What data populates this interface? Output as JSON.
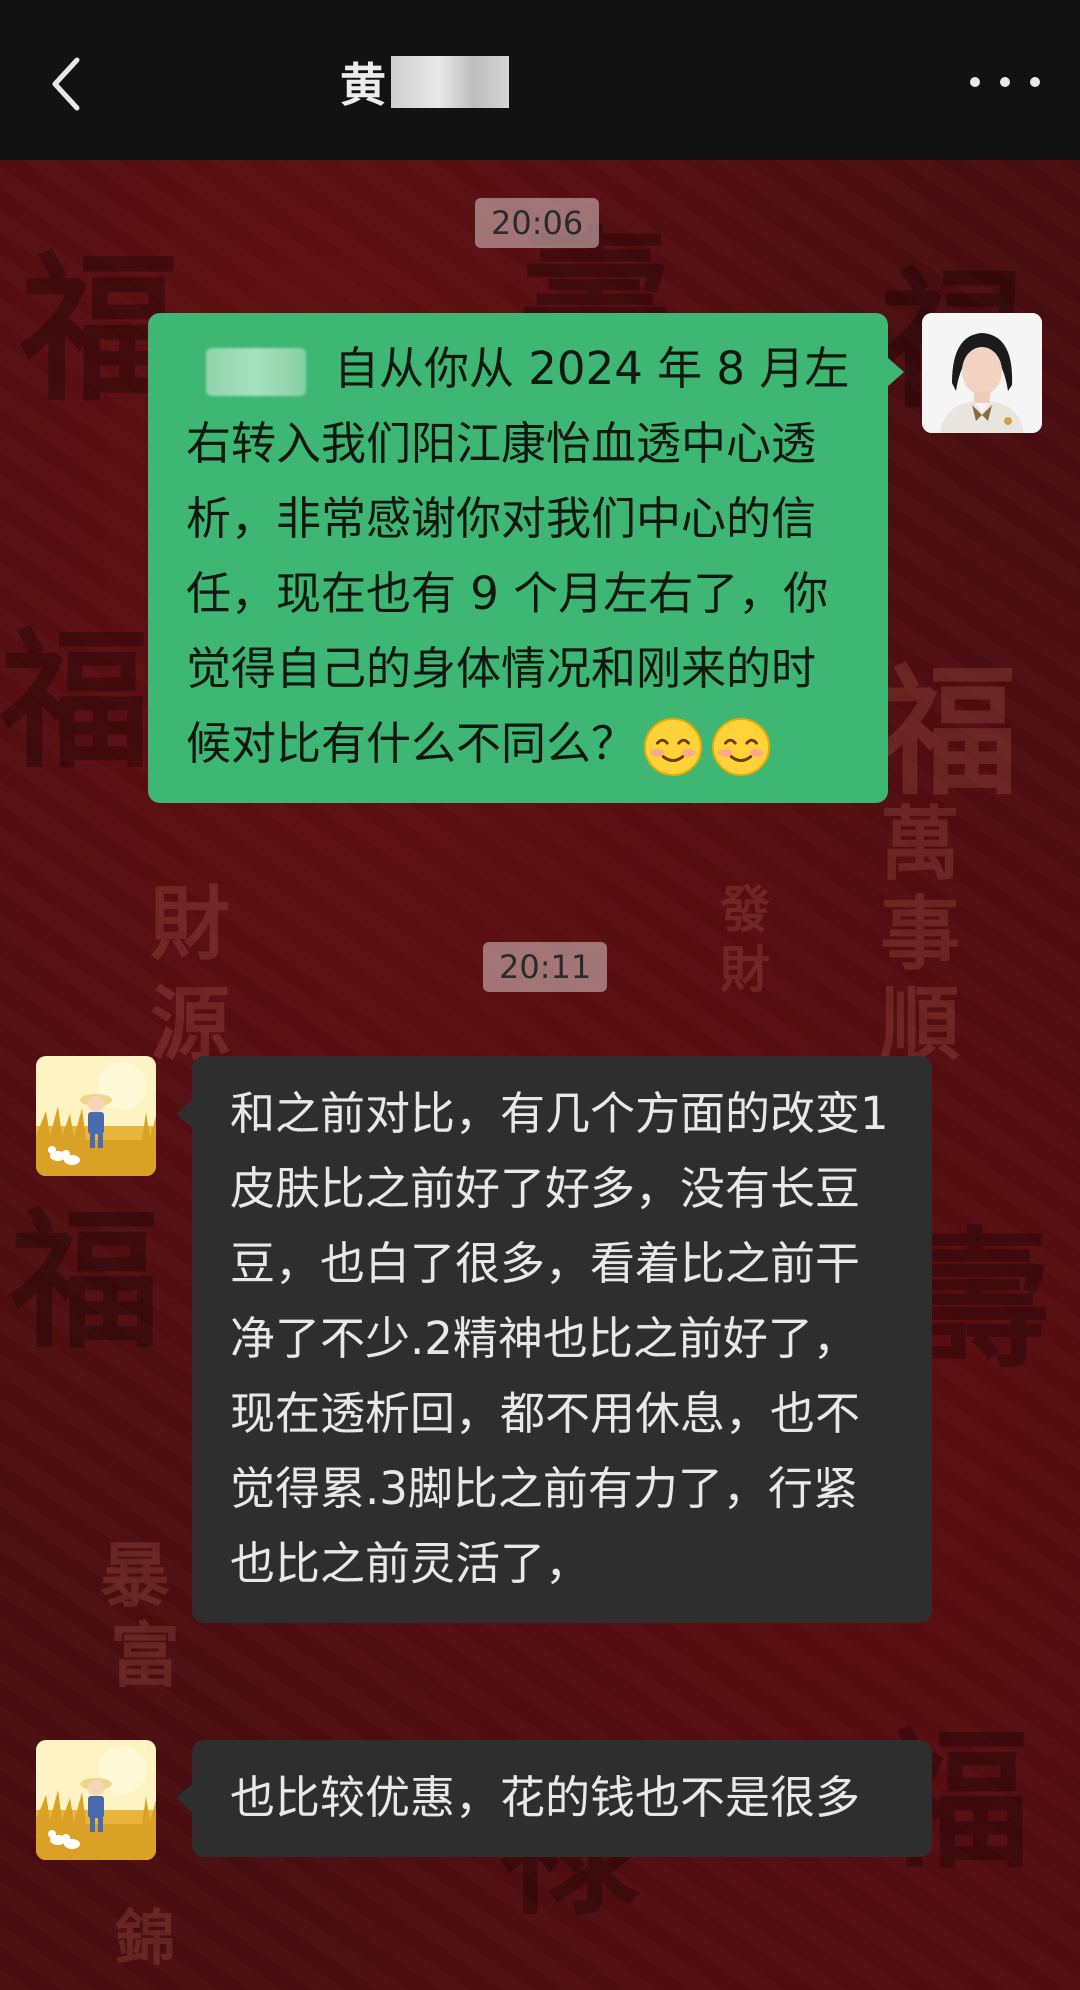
{
  "header": {
    "back_label": "",
    "title": "黄"
  },
  "timestamps": [
    "20:06",
    "20:11"
  ],
  "messages": [
    {
      "from": "me",
      "text": "自从你从 2024 年 8 月左右转入我们阳江康怡血透中心透析，非常感谢你对我们中心的信任，现在也有 9 个月左右了，你觉得自己的身体情况和刚来的时候对比有什么不同么？",
      "emoji_count": 2
    },
    {
      "from": "other",
      "text": "和之前对比，有几个方面的改变1皮肤比之前好了好多，没有长豆豆，也白了很多，看着比之前干净了不少.2精神也比之前好了，现在透析回，都不用休息，也不觉得累.3脚比之前有力了，行紧也比之前灵活了，"
    },
    {
      "from": "other",
      "text": "也比较优惠，花的钱也不是很多"
    }
  ],
  "background_chars": [
    "福",
    "萬",
    "事",
    "順",
    "財",
    "源",
    "發",
    "財",
    "暴",
    "富",
    "錦"
  ],
  "colors": {
    "topbar": "#121212",
    "bubble_me": "#3fb774",
    "bubble_other": "#2e2e2e",
    "background": "#4a0d10"
  },
  "icons": {
    "back": "chevron-left-icon",
    "more": "more-dots-icon"
  }
}
